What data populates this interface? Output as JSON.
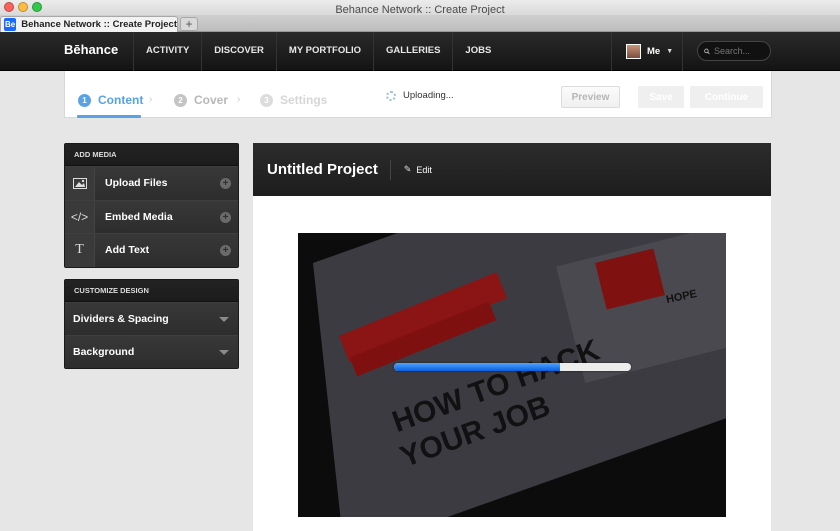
{
  "window": {
    "title": "Behance Network :: Create Project"
  },
  "tab": {
    "favicon": "Be",
    "label": "Behance Network :: Create Project",
    "new_tab": "+"
  },
  "nav": {
    "logo": "Bēhance",
    "items": [
      "ACTIVITY",
      "DISCOVER",
      "MY PORTFOLIO",
      "GALLERIES",
      "JOBS"
    ],
    "user_label": "Me",
    "search_placeholder": "Search..."
  },
  "steps": {
    "items": [
      {
        "num": "1",
        "label": "Content"
      },
      {
        "num": "2",
        "label": "Cover"
      },
      {
        "num": "3",
        "label": "Settings"
      }
    ],
    "status": "Uploading...",
    "preview": "Preview",
    "save": "Save",
    "continue": "Continue"
  },
  "add_media": {
    "header": "ADD MEDIA",
    "items": [
      {
        "label": "Upload Files",
        "icon": "image-icon"
      },
      {
        "label": "Embed Media",
        "icon": "code-icon",
        "glyph": "</>"
      },
      {
        "label": "Add Text",
        "icon": "text-icon",
        "glyph": "T"
      }
    ]
  },
  "customize": {
    "header": "CUSTOMIZE DESIGN",
    "items": [
      "Dividers & Spacing",
      "Background"
    ]
  },
  "project": {
    "title": "Untitled Project",
    "edit_label": "Edit",
    "upload_progress": 0.7
  },
  "media_text": {
    "headline1": "HOW TO HACK",
    "headline2": "YOUR JOB",
    "hope": "HOPE"
  },
  "colors": {
    "accent": "#5aa2e6",
    "progress": "#1a6fe8",
    "nav_bg": "#1b1b1b"
  }
}
